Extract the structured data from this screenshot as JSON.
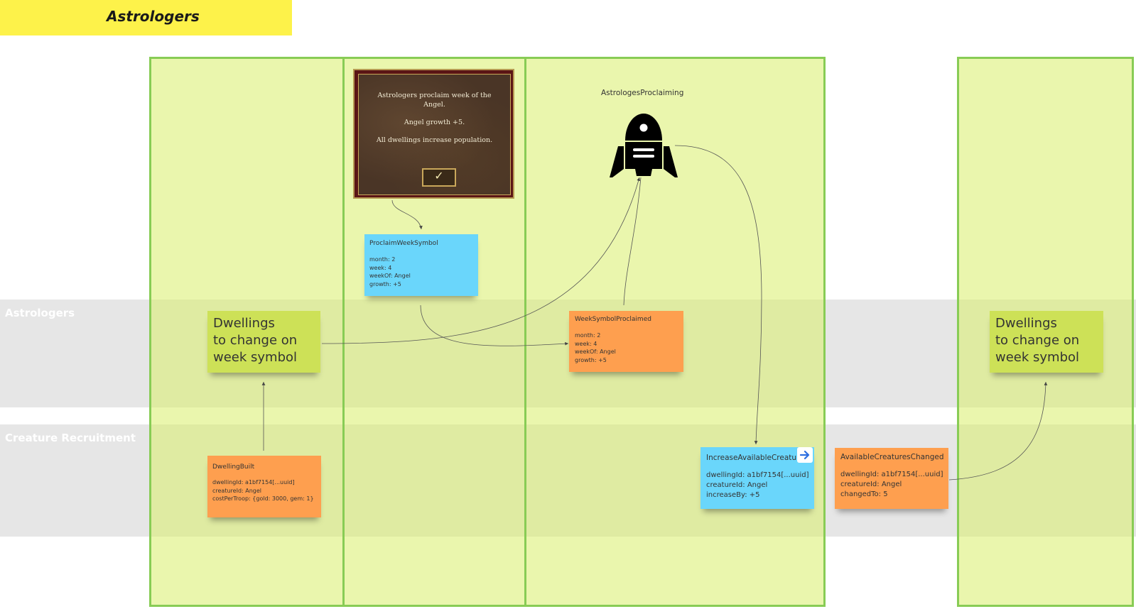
{
  "board_title": "Astrologers",
  "lanes": [
    {
      "label": "Astrologers"
    },
    {
      "label": "Creature Recruitment"
    }
  ],
  "scroll": {
    "line1": "Astrologers proclaim week of the",
    "line2": "Angel.",
    "line3": "Angel growth +5.",
    "line4": "All dwellings increase population.",
    "ok_symbol": "✓"
  },
  "actor": {
    "label": "AstrologesProclaiming",
    "icon": "robot-icon"
  },
  "stickies": {
    "view_left": {
      "l1": "Dwellings",
      "l2": "to change on",
      "l3": "week symbol"
    },
    "view_right": {
      "l1": "Dwellings",
      "l2": "to change on",
      "l3": "week symbol"
    },
    "proclaim_command": {
      "title": "ProclaimWeekSymbol",
      "lines": [
        "month: 2",
        "week: 4",
        "weekOf: Angel",
        "growth: +5"
      ]
    },
    "proclaimed_event": {
      "title": "WeekSymbolProclaimed",
      "lines": [
        "month: 2",
        "week: 4",
        "weekOf: Angel",
        "growth: +5"
      ]
    },
    "dwelling_built": {
      "title": "DwellingBuilt",
      "lines": [
        "dwellingId: a1bf7154[...uuid]",
        "creatureId: Angel",
        "costPerTroop: {gold: 3000, gem: 1}"
      ]
    },
    "increase_command": {
      "title": "IncreaseAvailableCreatures",
      "lines": [
        "dwellingId: a1bf7154[...uuid]",
        "creatureId: Angel",
        "increaseBy: +5"
      ]
    },
    "changed_event": {
      "title": "AvailableCreaturesChanged",
      "lines": [
        "dwellingId: a1bf7154[...uuid]",
        "creatureId: Angel",
        "changedTo: 5"
      ]
    }
  },
  "colors": {
    "column_fill": "#e5f1a0",
    "column_border": "#88cc55",
    "lane_fill": "#e6e6e6",
    "view_sticky": "#cde157",
    "command_sticky": "#6ad6fb",
    "event_sticky": "#fe9f4f",
    "title_banner": "#fdf24a"
  }
}
